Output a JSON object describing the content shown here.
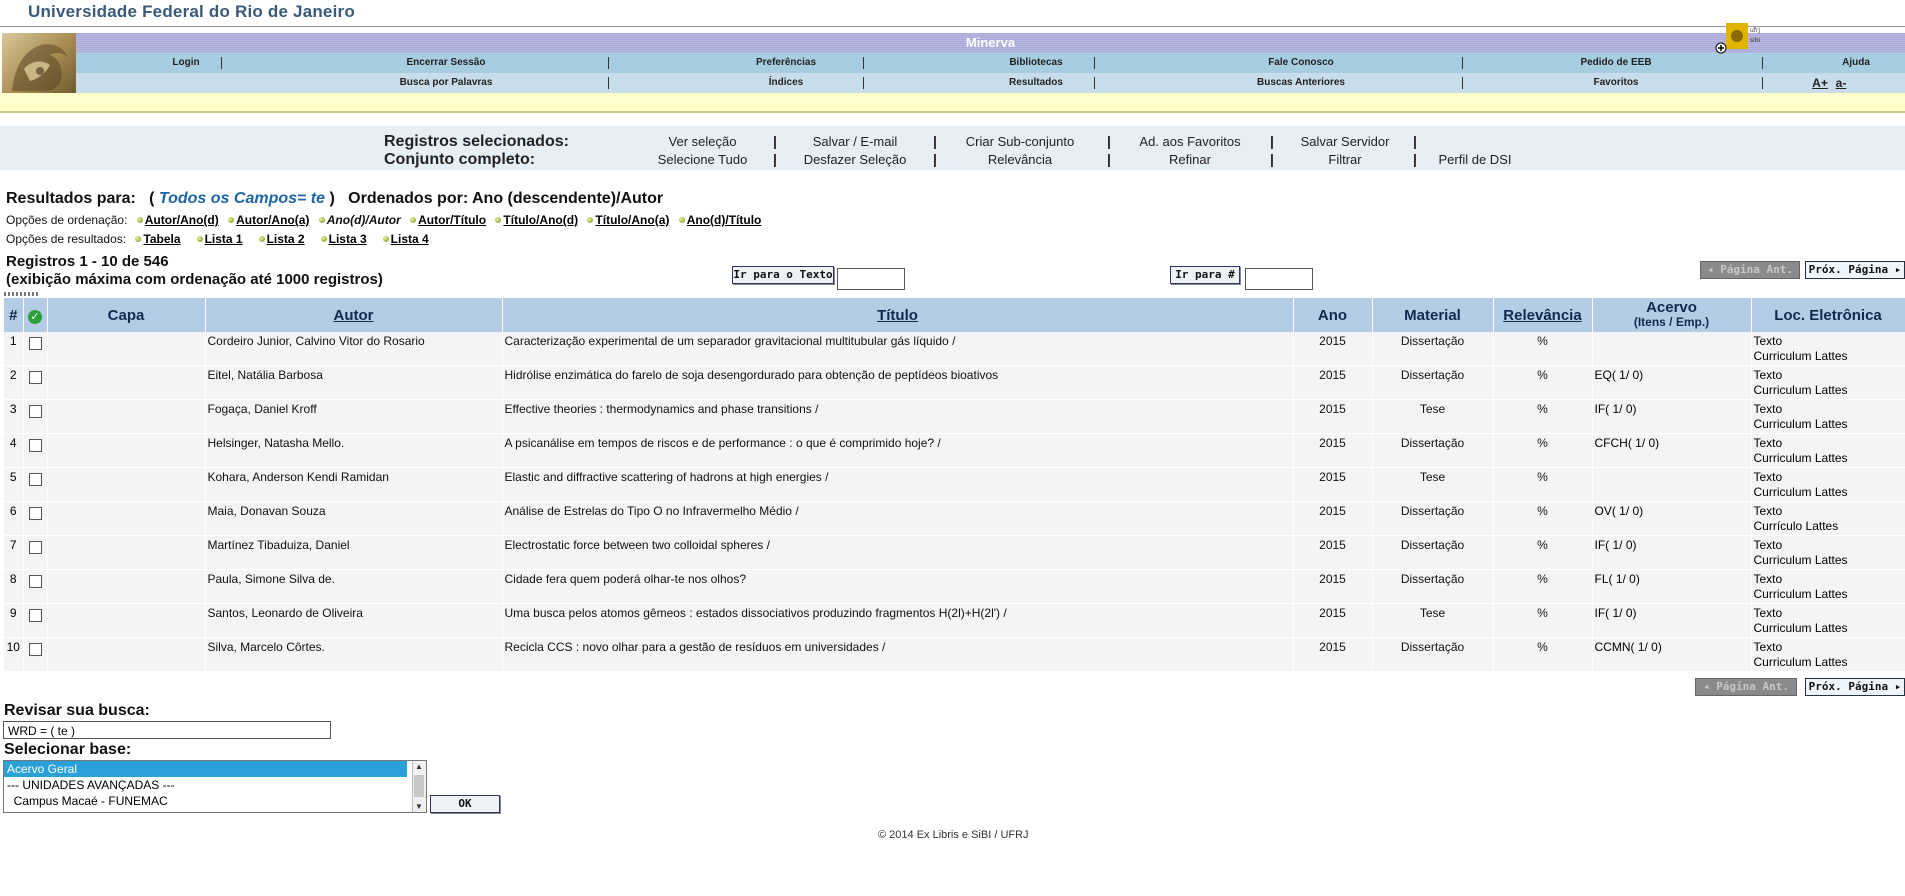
{
  "university": "Universidade Federal do Rio de Janeiro",
  "header": {
    "title": "Minerva",
    "row1": [
      "Login",
      "Encerrar Sessão",
      "Preferências",
      "Bibliotecas",
      "Fale Conosco",
      "Pedido de EEB",
      "Ajuda"
    ],
    "row2": [
      "Busca por Palavras",
      "Índices",
      "Resultados",
      "Buscas Anteriores",
      "Favoritos"
    ],
    "font_controls": [
      "A+",
      "a-"
    ]
  },
  "selection": {
    "label1": "Registros selecionados:",
    "label2": "Conjunto completo:",
    "row1": [
      "Ver seleção",
      "Salvar / E-mail",
      "Criar Sub-conjunto",
      "Ad. aos Favoritos",
      "Salvar Servidor"
    ],
    "row2": [
      "Selecione Tudo",
      "Desfazer Seleção",
      "Relevância",
      "Refinar",
      "Filtrar",
      "Perfil de DSI"
    ]
  },
  "results": {
    "prefix": "Resultados para:",
    "query": "Todos os Campos= te",
    "ordered": "Ordenados por: Ano (descendente)/Autor",
    "sort_label": "Opções de ordenação:",
    "sort_options": [
      "Autor/Ano(d)",
      "Autor/Ano(a)",
      "Ano(d)/Autor",
      "Autor/Título",
      "Título/Ano(d)",
      "Título/Ano(a)",
      "Ano(d)/Título"
    ],
    "format_label": "Opções de resultados:",
    "format_options": [
      "Tabela",
      "Lista 1",
      "Lista 2",
      "Lista 3",
      "Lista 4"
    ],
    "registros": "Registros 1 - 10 de 546",
    "note": "(exibição máxima com ordenação até 1000 registros)",
    "goto_text": "Ir para o Texto",
    "goto_num": "Ir para #",
    "prev": "Página Ant.",
    "next": "Próx. Página"
  },
  "table": {
    "headers": {
      "num": "#",
      "capa": "Capa",
      "autor": "Autor",
      "titulo": "Título",
      "ano": "Ano",
      "material": "Material",
      "relevancia": "Relevância",
      "acervo": "Acervo",
      "acervo_sub": "(Itens / Emp.)",
      "loc": "Loc. Eletrônica"
    },
    "rows": [
      {
        "num": "1",
        "autor": "Cordeiro Junior, Calvino Vitor do Rosario",
        "titulo": "Caracterização experimental de um separador gravitacional multitubular gás líquido /",
        "ano": "2015",
        "material": "Dissertação",
        "rel": "%",
        "acervo": "",
        "link1": "Texto",
        "link2": "Curriculum Lattes"
      },
      {
        "num": "2",
        "autor": "Eitel, Natália Barbosa",
        "titulo": "Hidrólise enzimática do farelo de soja desengordurado para obtenção de peptídeos bioativos",
        "ano": "2015",
        "material": "Dissertação",
        "rel": "%",
        "acervo": "EQ( 1/ 0)",
        "link1": "Texto",
        "link2": "Curriculum Lattes"
      },
      {
        "num": "3",
        "autor": "Fogaça, Daniel Kroff",
        "titulo": "Effective theories : thermodynamics and phase transitions /",
        "ano": "2015",
        "material": "Tese",
        "rel": "%",
        "acervo": "IF( 1/ 0)",
        "link1": "Texto",
        "link2": "Curriculum Lattes"
      },
      {
        "num": "4",
        "autor": "Helsinger, Natasha Mello.",
        "titulo": "A psicanálise em tempos de riscos e de performance : o que é comprimido hoje? /",
        "ano": "2015",
        "material": "Dissertação",
        "rel": "%",
        "acervo": "CFCH( 1/ 0)",
        "link1": "Texto",
        "link2": "Curriculum Lattes"
      },
      {
        "num": "5",
        "autor": "Kohara, Anderson Kendi Ramidan",
        "titulo": "Elastic and diffractive scattering of hadrons at high energies /",
        "ano": "2015",
        "material": "Tese",
        "rel": "%",
        "acervo": "",
        "link1": "Texto",
        "link2": "Curriculum Lattes"
      },
      {
        "num": "6",
        "autor": "Maia, Donavan Souza",
        "titulo": "Análise de Estrelas do Tipo O no Infravermelho Médio /",
        "ano": "2015",
        "material": "Dissertação",
        "rel": "%",
        "acervo": "OV( 1/ 0)",
        "link1": "Texto",
        "link2": "Currículo Lattes"
      },
      {
        "num": "7",
        "autor": "Martínez Tibaduiza, Daniel",
        "titulo": "Electrostatic force between two colloidal spheres /",
        "ano": "2015",
        "material": "Dissertação",
        "rel": "%",
        "acervo": "IF( 1/ 0)",
        "link1": "Texto",
        "link2": "Curriculum Lattes"
      },
      {
        "num": "8",
        "autor": "Paula, Simone Silva de.",
        "titulo": "Cidade fera quem poderá olhar-te nos olhos?",
        "ano": "2015",
        "material": "Dissertação",
        "rel": "%",
        "acervo": "FL( 1/ 0)",
        "link1": "Texto",
        "link2": "Curriculum Lattes"
      },
      {
        "num": "9",
        "autor": "Santos, Leonardo de Oliveira",
        "titulo": "Uma busca pelos atomos gêmeos : estados dissociativos produzindo fragmentos H(2l)+H(2l')  /",
        "ano": "2015",
        "material": "Tese",
        "rel": "%",
        "acervo": "IF( 1/ 0)",
        "link1": "Texto",
        "link2": "Curriculum Lattes"
      },
      {
        "num": "10",
        "autor": "Silva, Marcelo Côrtes.",
        "titulo": "Recicla CCS : novo olhar para a gestão de resíduos em universidades /",
        "ano": "2015",
        "material": "Dissertação",
        "rel": "%",
        "acervo": "CCMN( 1/ 0)",
        "link1": "Texto",
        "link2": "Curriculum Lattes"
      }
    ]
  },
  "revise": {
    "label": "Revisar sua busca:",
    "value": "WRD = ( te )",
    "base_label": "Selecionar base:",
    "options": [
      "Acervo Geral",
      "--- UNIDADES AVANÇADAS ---",
      "  Campus Macaé - FUNEMAC"
    ],
    "ok": "OK"
  },
  "footer": "© 2014 Ex Libris e SiBI / UFRJ"
}
